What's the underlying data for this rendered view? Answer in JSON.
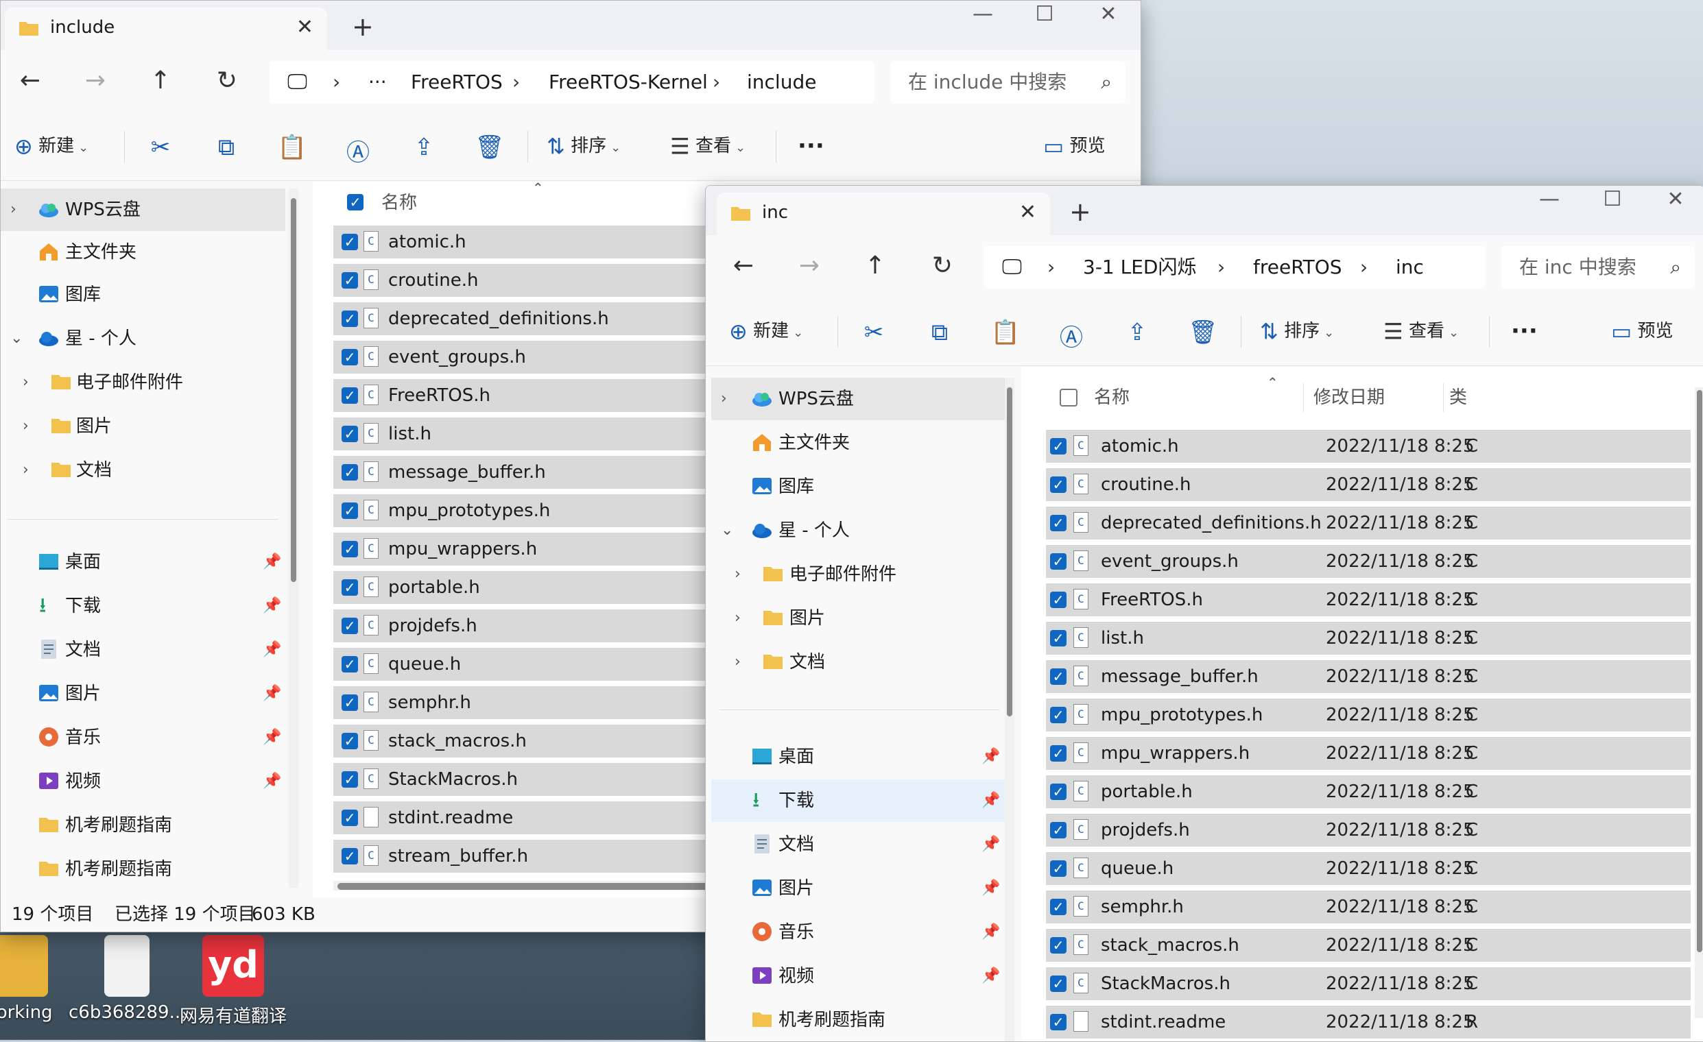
{
  "desktop": {
    "icons": [
      {
        "label": "working",
        "color": "#e6b23a"
      },
      {
        "label": "c6b368289...",
        "color": "#f2f2f2"
      },
      {
        "label": "网易有道翻译",
        "color": "#e8323c",
        "badge": "yd"
      }
    ]
  },
  "win1": {
    "tab_title": "include",
    "address": {
      "crumbs": [
        "FreeRTOS",
        "FreeRTOS-Kernel",
        "include"
      ],
      "ellipsis": "···"
    },
    "search_placeholder": "在 include 中搜索",
    "toolbar": {
      "new": "新建",
      "sort": "排序",
      "view": "查看",
      "more": "···",
      "preview": "预览"
    },
    "header": {
      "name": "名称"
    },
    "sidebar": {
      "tree": [
        {
          "label": "WPS云盘",
          "icon": "cloud-icon"
        },
        {
          "label": "主文件夹",
          "icon": "home-icon"
        },
        {
          "label": "图库",
          "icon": "gallery-icon"
        },
        {
          "label": "星 - 个人",
          "icon": "onedrive-icon"
        },
        {
          "label": "电子邮件附件",
          "icon": "folder-icon"
        },
        {
          "label": "图片",
          "icon": "folder-icon"
        },
        {
          "label": "文档",
          "icon": "folder-icon"
        }
      ],
      "quick": [
        {
          "label": "桌面",
          "icon": "desktop-icon"
        },
        {
          "label": "下载",
          "icon": "download-icon"
        },
        {
          "label": "文档",
          "icon": "document-icon"
        },
        {
          "label": "图片",
          "icon": "pictures-icon"
        },
        {
          "label": "音乐",
          "icon": "music-icon"
        },
        {
          "label": "视频",
          "icon": "video-icon"
        },
        {
          "label": "机考刷题指南",
          "icon": "folder-icon"
        },
        {
          "label": "机考刷题指南",
          "icon": "folder-icon"
        }
      ]
    },
    "files": [
      "atomic.h",
      "croutine.h",
      "deprecated_definitions.h",
      "event_groups.h",
      "FreeRTOS.h",
      "list.h",
      "message_buffer.h",
      "mpu_prototypes.h",
      "mpu_wrappers.h",
      "portable.h",
      "projdefs.h",
      "queue.h",
      "semphr.h",
      "stack_macros.h",
      "StackMacros.h",
      "stdint.readme",
      "stream_buffer.h"
    ],
    "status": {
      "count": "19 个项目",
      "selected": "已选择 19 个项目",
      "size": "603 KB"
    }
  },
  "win2": {
    "tab_title": "inc",
    "address": {
      "crumbs": [
        "3-1 LED闪烁",
        "freeRTOS",
        "inc"
      ]
    },
    "search_placeholder": "在 inc 中搜索",
    "toolbar": {
      "new": "新建",
      "sort": "排序",
      "view": "查看",
      "more": "···",
      "preview": "预览"
    },
    "header": {
      "name": "名称",
      "date": "修改日期",
      "type_clip": "类"
    },
    "sidebar": {
      "tree": [
        {
          "label": "WPS云盘",
          "icon": "cloud-icon"
        },
        {
          "label": "主文件夹",
          "icon": "home-icon"
        },
        {
          "label": "图库",
          "icon": "gallery-icon"
        },
        {
          "label": "星 - 个人",
          "icon": "onedrive-icon"
        },
        {
          "label": "电子邮件附件",
          "icon": "folder-icon"
        },
        {
          "label": "图片",
          "icon": "folder-icon"
        },
        {
          "label": "文档",
          "icon": "folder-icon"
        }
      ],
      "quick": [
        {
          "label": "桌面",
          "icon": "desktop-icon"
        },
        {
          "label": "下载",
          "icon": "download-icon"
        },
        {
          "label": "文档",
          "icon": "document-icon"
        },
        {
          "label": "图片",
          "icon": "pictures-icon"
        },
        {
          "label": "音乐",
          "icon": "music-icon"
        },
        {
          "label": "视频",
          "icon": "video-icon"
        },
        {
          "label": "机考刷题指南",
          "icon": "folder-icon"
        }
      ]
    },
    "files": [
      {
        "name": "atomic.h",
        "date": "2022/11/18 8:25",
        "clip": "C"
      },
      {
        "name": "croutine.h",
        "date": "2022/11/18 8:25",
        "clip": "C"
      },
      {
        "name": "deprecated_definitions.h",
        "date": "2022/11/18 8:25",
        "clip": "C"
      },
      {
        "name": "event_groups.h",
        "date": "2022/11/18 8:25",
        "clip": "C"
      },
      {
        "name": "FreeRTOS.h",
        "date": "2022/11/18 8:25",
        "clip": "C"
      },
      {
        "name": "list.h",
        "date": "2022/11/18 8:25",
        "clip": "C"
      },
      {
        "name": "message_buffer.h",
        "date": "2022/11/18 8:25",
        "clip": "C"
      },
      {
        "name": "mpu_prototypes.h",
        "date": "2022/11/18 8:25",
        "clip": "C"
      },
      {
        "name": "mpu_wrappers.h",
        "date": "2022/11/18 8:25",
        "clip": "C"
      },
      {
        "name": "portable.h",
        "date": "2022/11/18 8:25",
        "clip": "C"
      },
      {
        "name": "projdefs.h",
        "date": "2022/11/18 8:25",
        "clip": "C"
      },
      {
        "name": "queue.h",
        "date": "2022/11/18 8:25",
        "clip": "C"
      },
      {
        "name": "semphr.h",
        "date": "2022/11/18 8:25",
        "clip": "C"
      },
      {
        "name": "stack_macros.h",
        "date": "2022/11/18 8:25",
        "clip": "C"
      },
      {
        "name": "StackMacros.h",
        "date": "2022/11/18 8:25",
        "clip": "C"
      },
      {
        "name": "stdint.readme",
        "date": "2022/11/18 8:25",
        "clip": "R"
      }
    ]
  }
}
